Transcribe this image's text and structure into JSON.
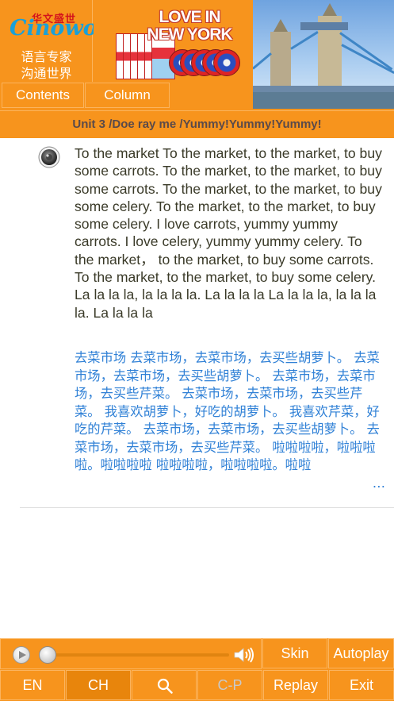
{
  "header": {
    "logo": {
      "brand_cn": "华文盛世",
      "brand_word": "Cinowo",
      "slogan_line1": "语言专家",
      "slogan_line2": "沟通世界"
    },
    "banner": {
      "title_line1": "LOVE IN",
      "title_line2": "NEW YORK"
    },
    "photo_icon": "tower-bridge-photo",
    "nav": {
      "contents_label": "Contents",
      "column_label": "Column"
    },
    "unit_title": "Unit 3 /Doe ray me /Yummy!Yummy!Yummy!"
  },
  "content": {
    "speaker_icon": "speaker-icon",
    "english": "To the market To the market, to the market, to buy some carrots. To the market, to the market, to buy some carrots. To the market, to the market, to buy some celery. To the market, to the market, to buy some celery. I love carrots, yummy yummy carrots. I love celery, yummy yummy celery. To the market， to the market, to buy some carrots. To the market, to the market, to buy some celery. La la la la, la la la la. La la la la La la la la, la la la la. La la la la",
    "chinese": "去菜市场 去菜市场，去菜市场，去买些胡萝卜。 去菜市场，去菜市场，去买些胡萝卜。 去菜市场，去菜市场，去买些芹菜。 去菜市场，去菜市场，去买些芹菜。 我喜欢胡萝卜，好吃的胡萝卜。 我喜欢芹菜，好吃的芹菜。 去菜市场，去菜市场，去买些胡萝卜。 去菜市场，去菜市场，去买些芹菜。 啦啦啦啦，啦啦啦啦。啦啦啦啦 啦啦啦啦，啦啦啦啦。啦啦",
    "chinese_ellipsis": "…"
  },
  "player": {
    "play_icon": "play-icon",
    "progress": 0,
    "volume_icon": "volume-icon"
  },
  "buttons": {
    "skin": "Skin",
    "autoplay": "Autoplay",
    "en": "EN",
    "ch": "CH",
    "search_icon": "search-icon",
    "cp": "C-P",
    "replay": "Replay",
    "exit": "Exit"
  },
  "colors": {
    "accent": "#f7941d",
    "chinese_text": "#2f80d6",
    "english_text": "#3a3a28",
    "disabled": "#c9c9c9"
  }
}
